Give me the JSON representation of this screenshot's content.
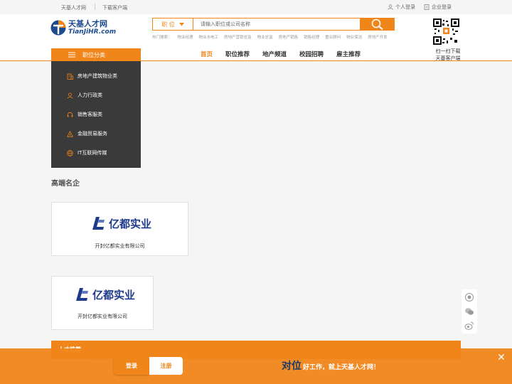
{
  "topbar": {
    "site_link": "天基人才网",
    "download_link": "下载客户端",
    "personal_login": "个人登录",
    "enterprise_login": "企业登录"
  },
  "logo": {
    "cn": "天基人才网",
    "en": "TianJiHR.com"
  },
  "search": {
    "type_label": "职 位",
    "placeholder": "请输入职位或公司名称"
  },
  "hot_search": {
    "label": "热门搜索：",
    "terms": [
      "物业经理",
      "物业水电工",
      "房地产营销总监",
      "物业总监",
      "房地产销售",
      "销售经理",
      "置业顾问",
      "物业保洁",
      "房地产开发"
    ]
  },
  "qr": {
    "line1": "扫一扫下载",
    "line2": "天基客户端"
  },
  "categories": {
    "header": "职位分类",
    "items": [
      {
        "label": "房地产建筑物业类",
        "icon": "building-icon"
      },
      {
        "label": "人力行政类",
        "icon": "person-icon"
      },
      {
        "label": "销售客服类",
        "icon": "headset-icon"
      },
      {
        "label": "金融贸易服务",
        "icon": "finance-icon"
      },
      {
        "label": "IT互联网传媒",
        "icon": "globe-icon"
      }
    ]
  },
  "nav": {
    "items": [
      "首页",
      "职位推荐",
      "地产频道",
      "校园招聘",
      "雇主推荐"
    ],
    "active": "首页"
  },
  "section_title": "高端名企",
  "companies": [
    {
      "brand": "亿都实业",
      "name": "开封亿都实业有限公司"
    },
    {
      "brand": "亿都实业",
      "name": "开封亿都实业有限公司"
    }
  ],
  "partial_bar_title": "人才推荐",
  "footer": {
    "login": "登录",
    "register": "注册",
    "slogan_big": "对位",
    "slogan_rest": "好工作，就上天基人才网！",
    "close": "✕"
  },
  "colors": {
    "accent": "#f08519",
    "dark_menu": "#3a3a3a",
    "brand_blue": "#1e3a8a"
  }
}
